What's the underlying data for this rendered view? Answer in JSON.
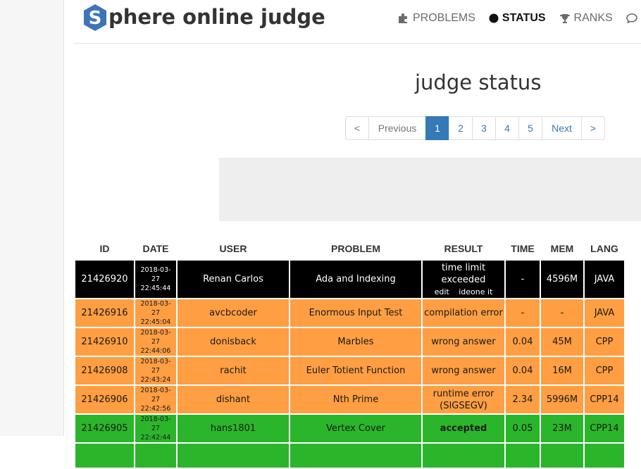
{
  "brand": {
    "logo_letter": "S",
    "name_rest": "phere online judge",
    "hex_color": "#3e74b8"
  },
  "nav": [
    {
      "label": "PROBLEMS",
      "icon": "puzzle-icon",
      "active": false
    },
    {
      "label": "STATUS",
      "icon": "filled-circle-icon",
      "active": true
    },
    {
      "label": "RANKS",
      "icon": "trophy-icon",
      "active": false
    }
  ],
  "page_title": "judge status",
  "pagination": {
    "first": "<",
    "prev": "Previous",
    "pages": [
      "1",
      "2",
      "3",
      "4",
      "5"
    ],
    "current": "1",
    "next": "Next",
    "last": ">"
  },
  "table": {
    "headers": {
      "id": "ID",
      "date": "DATE",
      "user": "USER",
      "problem": "PROBLEM",
      "result": "RESULT",
      "time": "TIME",
      "mem": "MEM",
      "lang": "LANG"
    },
    "rows": [
      {
        "id": "21426920",
        "date": "2018-03-27",
        "clock": "22:45:44",
        "user": "Renan Carlos",
        "problem": "Ada and Indexing",
        "result": "time limit exceeded",
        "result_links": [
          "edit",
          "ideone it"
        ],
        "time": "-",
        "mem": "4596M",
        "lang": "JAVA",
        "status": "black"
      },
      {
        "id": "21426916",
        "date": "2018-03-27",
        "clock": "22:45:04",
        "user": "avcbcoder",
        "problem": "Enormous Input Test",
        "result": "compilation error",
        "time": "-",
        "mem": "-",
        "lang": "JAVA",
        "status": "orange"
      },
      {
        "id": "21426910",
        "date": "2018-03-27",
        "clock": "22:44:06",
        "user": "donisback",
        "problem": "Marbles",
        "result": "wrong answer",
        "time": "0.04",
        "mem": "45M",
        "lang": "CPP",
        "status": "orange"
      },
      {
        "id": "21426908",
        "date": "2018-03-27",
        "clock": "22:43:24",
        "user": "rachit",
        "problem": "Euler Totient Function",
        "result": "wrong answer",
        "time": "0.04",
        "mem": "16M",
        "lang": "CPP",
        "status": "orange"
      },
      {
        "id": "21426906",
        "date": "2018-03-27",
        "clock": "22:42:56",
        "user": "dishant",
        "problem": "Nth Prime",
        "result": "runtime error",
        "result_sub": "(SIGSEGV)",
        "time": "2.34",
        "mem": "5996M",
        "lang": "CPP14",
        "status": "orange"
      },
      {
        "id": "21426905",
        "date": "2018-03-27",
        "clock": "22:42:44",
        "user": "hans1801",
        "problem": "Vertex Cover",
        "result": "accepted",
        "time": "0.05",
        "mem": "23M",
        "lang": "CPP14",
        "status": "green"
      }
    ]
  }
}
